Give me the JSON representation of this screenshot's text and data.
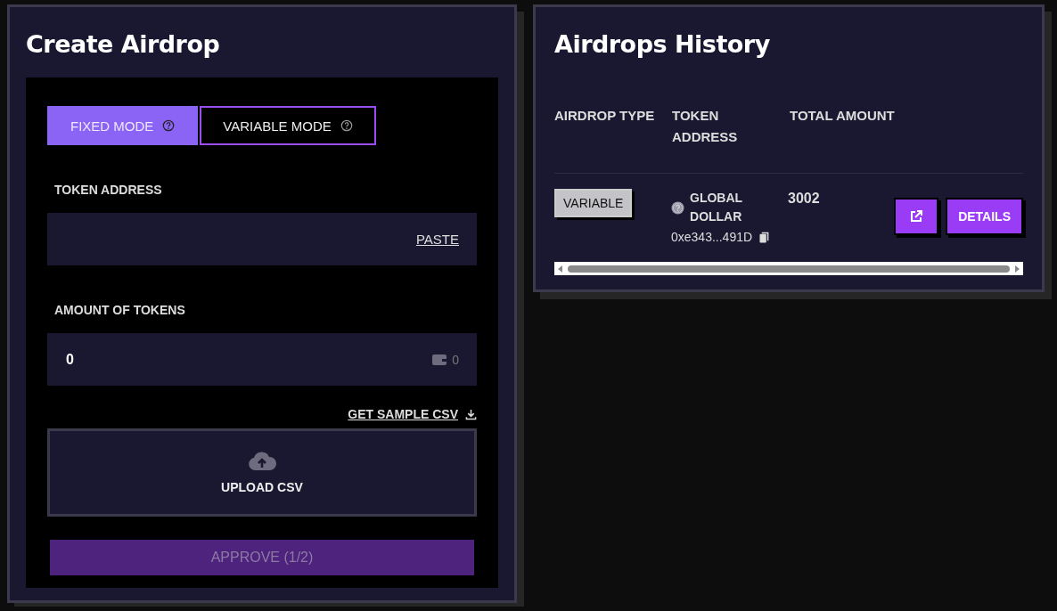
{
  "create_airdrop": {
    "title": "Create Airdrop",
    "modes": [
      {
        "label": "FIXED MODE",
        "selected": true
      },
      {
        "label": "VARIABLE MODE",
        "selected": false
      }
    ],
    "token_address": {
      "label": "TOKEN ADDRESS",
      "paste": "PASTE"
    },
    "amount": {
      "label": "AMOUNT OF TOKENS",
      "value": "0",
      "balance": "0"
    },
    "sample_csv": "GET SAMPLE CSV",
    "upload": "UPLOAD CSV",
    "approve": {
      "label": "APPROVE (1/2)",
      "disabled": true
    }
  },
  "history": {
    "title": "Airdrops History",
    "columns": [
      "AIRDROP TYPE",
      "TOKEN ADDRESS",
      "TOTAL AMOUNT"
    ],
    "rows": [
      {
        "type": "VARIABLE",
        "token_name": "GLOBAL DOLLAR",
        "address": "0xe343...491D",
        "total": "3002",
        "details": "DETAILS"
      }
    ]
  }
}
